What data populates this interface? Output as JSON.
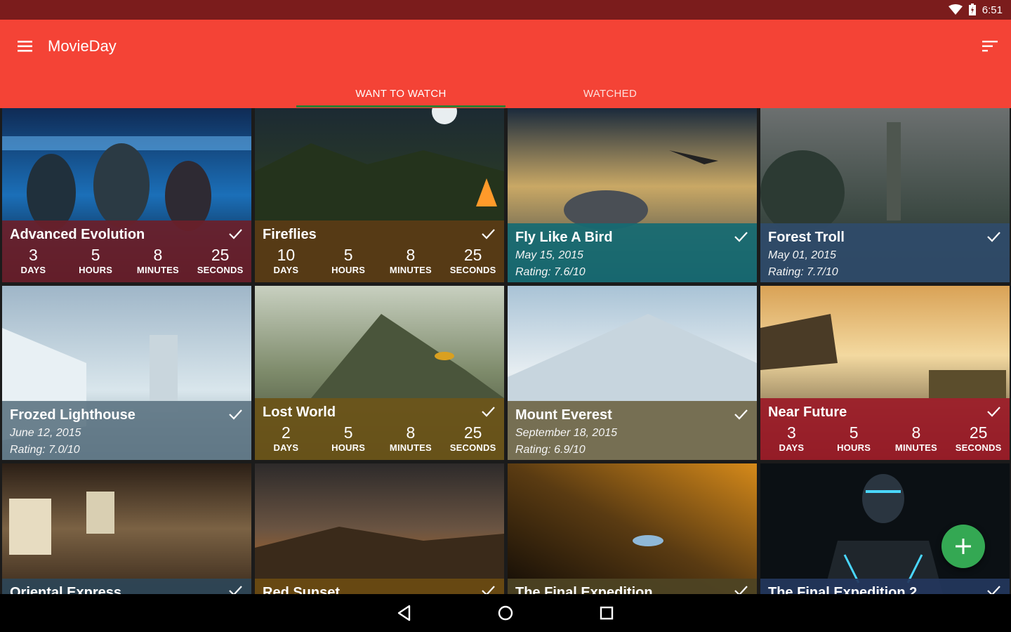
{
  "status_bar": {
    "time": "6:51",
    "wifi_icon": "wifi-icon",
    "battery_icon": "battery-icon"
  },
  "app": {
    "title": "MovieDay",
    "menu_icon": "menu-icon",
    "sort_icon": "sort-icon"
  },
  "tabs": [
    {
      "label": "WANT TO WATCH",
      "active": true
    },
    {
      "label": "WATCHED",
      "active": false
    }
  ],
  "counter_units": {
    "days": "DAYS",
    "hours": "HOURS",
    "minutes": "MINUTES",
    "seconds": "SECONDS"
  },
  "movies": [
    {
      "title": "Advanced Evolution",
      "type": "countdown",
      "days": "3",
      "hours": "5",
      "minutes": "8",
      "seconds": "25",
      "overlay_color": "#6b1f2a"
    },
    {
      "title": "Fireflies",
      "type": "countdown",
      "days": "10",
      "hours": "5",
      "minutes": "8",
      "seconds": "25",
      "overlay_color": "#5a3b14"
    },
    {
      "title": "Fly Like A Bird",
      "type": "info",
      "date": "May 15, 2015",
      "rating": "Rating: 7.6/10",
      "overlay_color": "#166a72"
    },
    {
      "title": "Forest Troll",
      "type": "info",
      "date": "May 01, 2015",
      "rating": "Rating: 7.7/10",
      "overlay_color": "#2f4b6b"
    },
    {
      "title": "Frozed Lighthouse",
      "type": "info",
      "date": "June 12, 2015",
      "rating": "Rating: 7.0/10",
      "overlay_color": "#5d7483"
    },
    {
      "title": "Lost World",
      "type": "countdown",
      "days": "2",
      "hours": "5",
      "minutes": "8",
      "seconds": "25",
      "overlay_color": "#6b5318"
    },
    {
      "title": "Mount Everest",
      "type": "info",
      "date": "September 18, 2015",
      "rating": "Rating: 6.9/10",
      "overlay_color": "#6f6647"
    },
    {
      "title": "Near Future",
      "type": "countdown",
      "days": "3",
      "hours": "5",
      "minutes": "8",
      "seconds": "25",
      "overlay_color": "#9b1b28"
    },
    {
      "title": "Oriental Express",
      "type": "partial",
      "overlay_color": "#2d4657"
    },
    {
      "title": "Red Sunset",
      "type": "partial",
      "overlay_color": "#6a4a12"
    },
    {
      "title": "The Final Expedition",
      "type": "partial",
      "overlay_color": "#4e4424"
    },
    {
      "title": "The Final Expedition 2",
      "type": "partial",
      "overlay_color": "#23375c"
    }
  ],
  "fab": {
    "icon": "plus-icon"
  },
  "nav": {
    "back_icon": "back-icon",
    "home_icon": "home-icon",
    "recents_icon": "recents-icon"
  }
}
